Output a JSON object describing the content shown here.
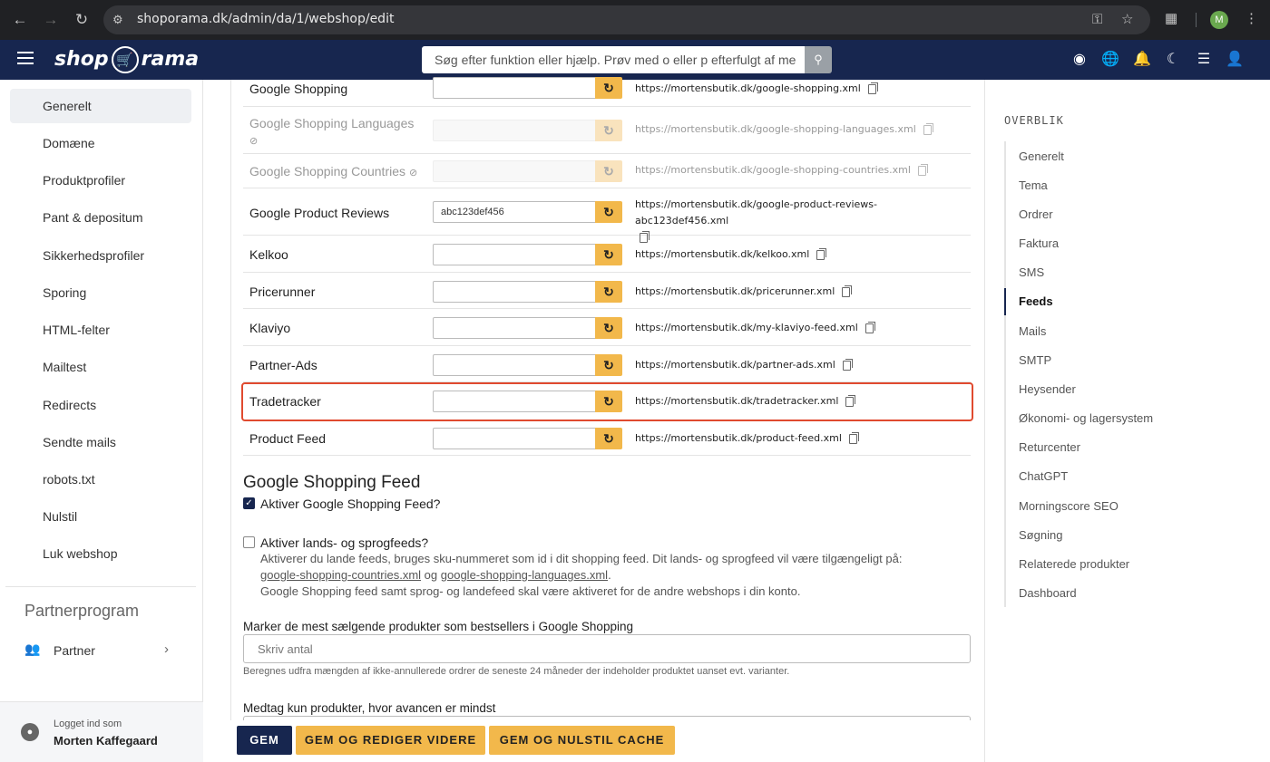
{
  "browser": {
    "url": "shoporama.dk/admin/da/1/webshop/edit",
    "profile_initial": "M"
  },
  "header": {
    "logo_left": "shop",
    "logo_right": "rama",
    "search_placeholder": "Søg efter funktion eller hjælp. Prøv med o eller p efterfulgt af me"
  },
  "sidebar": {
    "items": [
      {
        "label": "Generelt",
        "active": true
      },
      {
        "label": "Domæne"
      },
      {
        "label": "Produktprofiler"
      },
      {
        "label": "Pant & depositum"
      },
      {
        "label": "Sikkerhedsprofiler"
      },
      {
        "label": "Sporing"
      },
      {
        "label": "HTML-felter"
      },
      {
        "label": "Mailtest"
      },
      {
        "label": "Redirects"
      },
      {
        "label": "Sendte mails"
      },
      {
        "label": "robots.txt"
      },
      {
        "label": "Nulstil"
      },
      {
        "label": "Luk webshop"
      }
    ],
    "section_title": "Partnerprogram",
    "partner_label": "Partner",
    "login_caption": "Logget ind som",
    "login_user": "Morten Kaffegaard"
  },
  "feeds": [
    {
      "name": "Google Shopping",
      "value": "",
      "url": "https://mortensbutik.dk/google-shopping.xml",
      "disabled": false
    },
    {
      "name": "Google Shopping Languages",
      "value": "",
      "url": "https://mortensbutik.dk/google-shopping-languages.xml",
      "disabled": true
    },
    {
      "name": "Google Shopping Countries",
      "value": "",
      "url": "https://mortensbutik.dk/google-shopping-countries.xml",
      "disabled": true
    },
    {
      "name": "Google Product Reviews",
      "value": "abc123def456",
      "url": "https://mortensbutik.dk/google-product-reviews-abc123def456.xml",
      "disabled": false
    },
    {
      "name": "Kelkoo",
      "value": "",
      "url": "https://mortensbutik.dk/kelkoo.xml",
      "disabled": false
    },
    {
      "name": "Pricerunner",
      "value": "",
      "url": "https://mortensbutik.dk/pricerunner.xml",
      "disabled": false
    },
    {
      "name": "Klaviyo",
      "value": "",
      "url": "https://mortensbutik.dk/my-klaviyo-feed.xml",
      "disabled": false
    },
    {
      "name": "Partner-Ads",
      "value": "",
      "url": "https://mortensbutik.dk/partner-ads.xml",
      "disabled": false
    },
    {
      "name": "Tradetracker",
      "value": "",
      "url": "https://mortensbutik.dk/tradetracker.xml",
      "disabled": false
    },
    {
      "name": "Product Feed",
      "value": "",
      "url": "https://mortensbutik.dk/product-feed.xml",
      "disabled": false
    }
  ],
  "google_feed": {
    "title": "Google Shopping Feed",
    "activate_label": "Aktiver Google Shopping Feed?",
    "activate_checked": true,
    "country_label": "Aktiver lands- og sprogfeeds?",
    "country_checked": false,
    "desc_line1": "Aktiverer du lande feeds, bruges sku-nummeret som id i dit shopping feed. Dit lands- og sprogfeed vil være tilgængeligt på:",
    "desc_link1": "google-shopping-countries.xml",
    "desc_and": "og",
    "desc_link2": "google-shopping-languages.xml",
    "desc_period": ".",
    "desc_line3": "Google Shopping feed samt sprog- og landefeed skal være aktiveret for de andre webshops i din konto.",
    "bestseller_label": "Marker de mest sælgende produkter som bestsellers i Google Shopping",
    "bestseller_placeholder": "Skriv antal",
    "bestseller_hint": "Beregnes udfra mængden af ikke-annullerede ordrer de seneste 24 måneder der indeholder produktet uanset evt. varianter.",
    "margin_label": "Medtag kun produkter, hvor avancen er mindst"
  },
  "actions": {
    "save": "GEM",
    "save_continue": "GEM OG REDIGER VIDERE",
    "save_reset": "GEM OG NULSTIL CACHE"
  },
  "overview": {
    "title": "OVERBLIK",
    "items": [
      {
        "label": "Generelt"
      },
      {
        "label": "Tema"
      },
      {
        "label": "Ordrer"
      },
      {
        "label": "Faktura"
      },
      {
        "label": "SMS"
      },
      {
        "label": "Feeds",
        "active": true
      },
      {
        "label": "Mails"
      },
      {
        "label": "SMTP"
      },
      {
        "label": "Heysender"
      },
      {
        "label": "Økonomi- og lagersystem"
      },
      {
        "label": "Returcenter"
      },
      {
        "label": "ChatGPT"
      },
      {
        "label": "Morningscore SEO"
      },
      {
        "label": "Søgning"
      },
      {
        "label": "Relaterede produkter"
      },
      {
        "label": "Dashboard"
      }
    ]
  },
  "colors": {
    "brand_navy": "#17264f",
    "accent_orange": "#f2b84b",
    "highlight_red": "#e04a2f"
  }
}
